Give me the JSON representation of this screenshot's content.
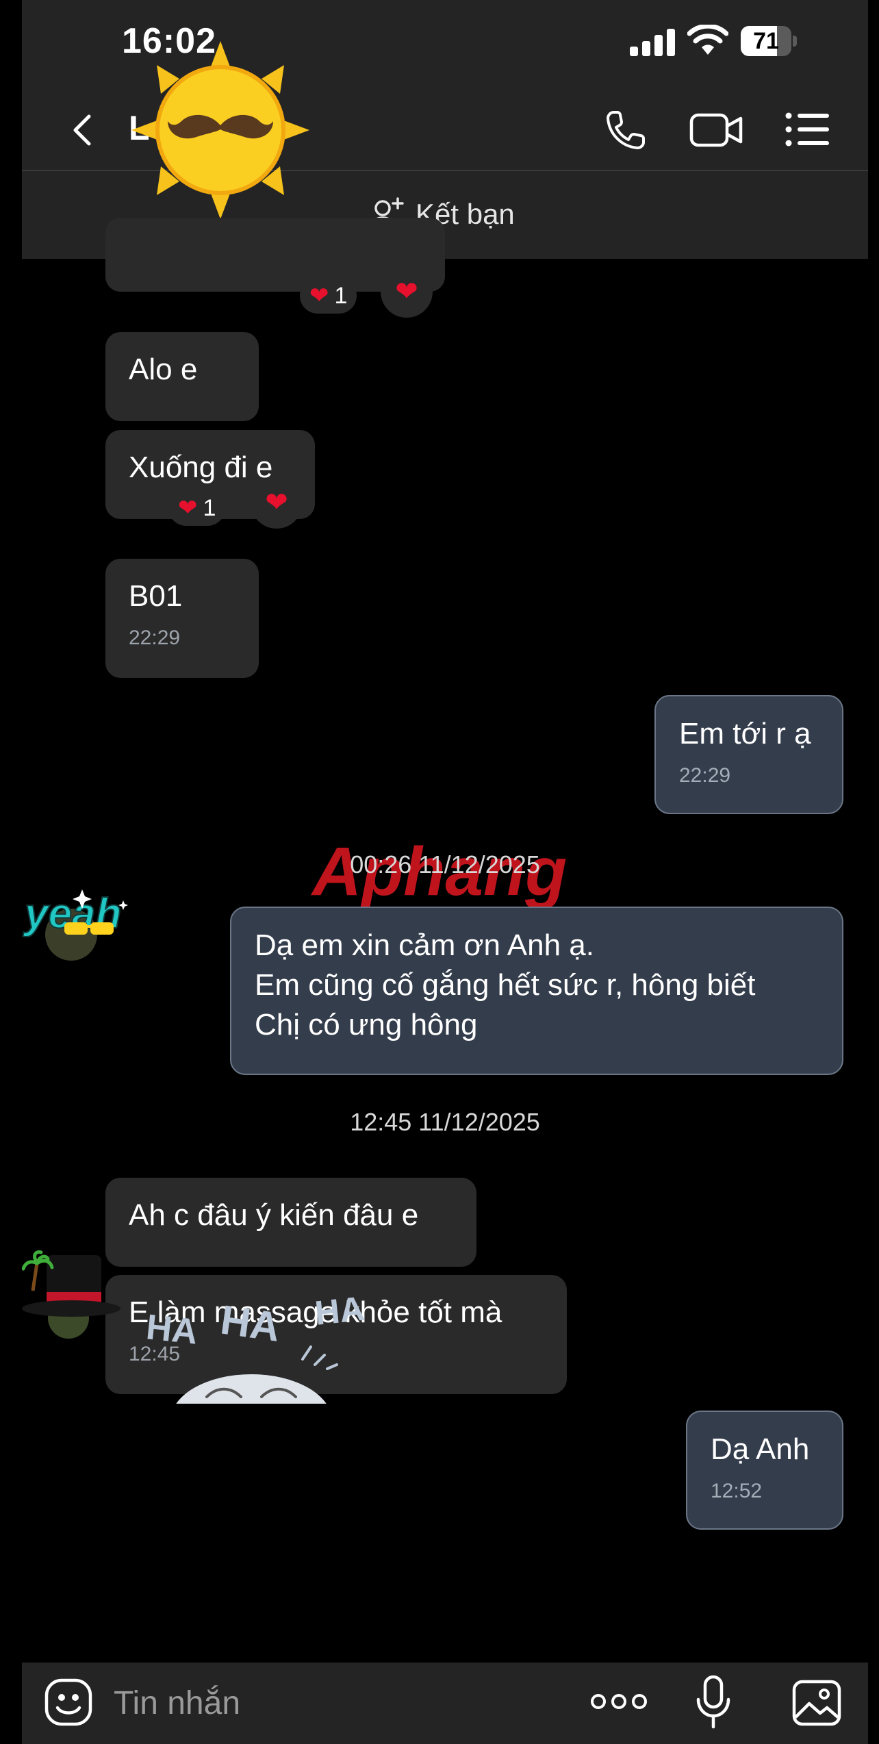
{
  "status_bar": {
    "time": "16:02",
    "battery": "71",
    "battery_level": 0.71
  },
  "header": {
    "contact_name": "L",
    "back_icon": "chevron-left-icon",
    "call_icon": "phone-icon",
    "video_icon": "video-camera-icon",
    "menu_icon": "list-menu-icon"
  },
  "friend_bar": {
    "label": "Kết bạn",
    "icon": "add-person-icon"
  },
  "messages": {
    "m1_reaction_count": "1",
    "m2_text": "Alo e",
    "m3_text": "Xuống đi e",
    "m3_reaction_count": "1",
    "m4_text": "B01",
    "m4_time": "22:29",
    "m5_text": "Em tới r ạ",
    "m5_time": "22:29",
    "sep1": "00:26 11/12/2025",
    "m6_line1": "Dạ em xin cảm ơn Anh ạ.",
    "m6_line2": "Em cũng cố gắng hết sức r, hông biết",
    "m6_line3": "Chị có ưng hông",
    "sep2": "12:45 11/12/2025",
    "m7_text": "Ah c đâu ý kiến đâu e",
    "m8_text": "E làm massage khỏe tốt mà",
    "m8_time": "12:45",
    "m9_text": "Dạ Anh",
    "m9_time": "12:52",
    "sticker_text_1": "HA",
    "sticker_text_2": "HA",
    "sticker_text_3": "HA",
    "avatar_sticker_text": "yeah",
    "watermark": "Aphang"
  },
  "input_bar": {
    "placeholder": "Tin nhắn",
    "emoji_icon": "smiley-icon",
    "more_icon": "more-dots-icon",
    "mic_icon": "microphone-icon",
    "gallery_icon": "image-icon"
  },
  "colors": {
    "bar_bg": "#242424",
    "incoming_bubble": "#2a2a2a",
    "outgoing_bubble": "#343d4c",
    "outgoing_border": "#6b7788",
    "heart": "#e8112d"
  }
}
